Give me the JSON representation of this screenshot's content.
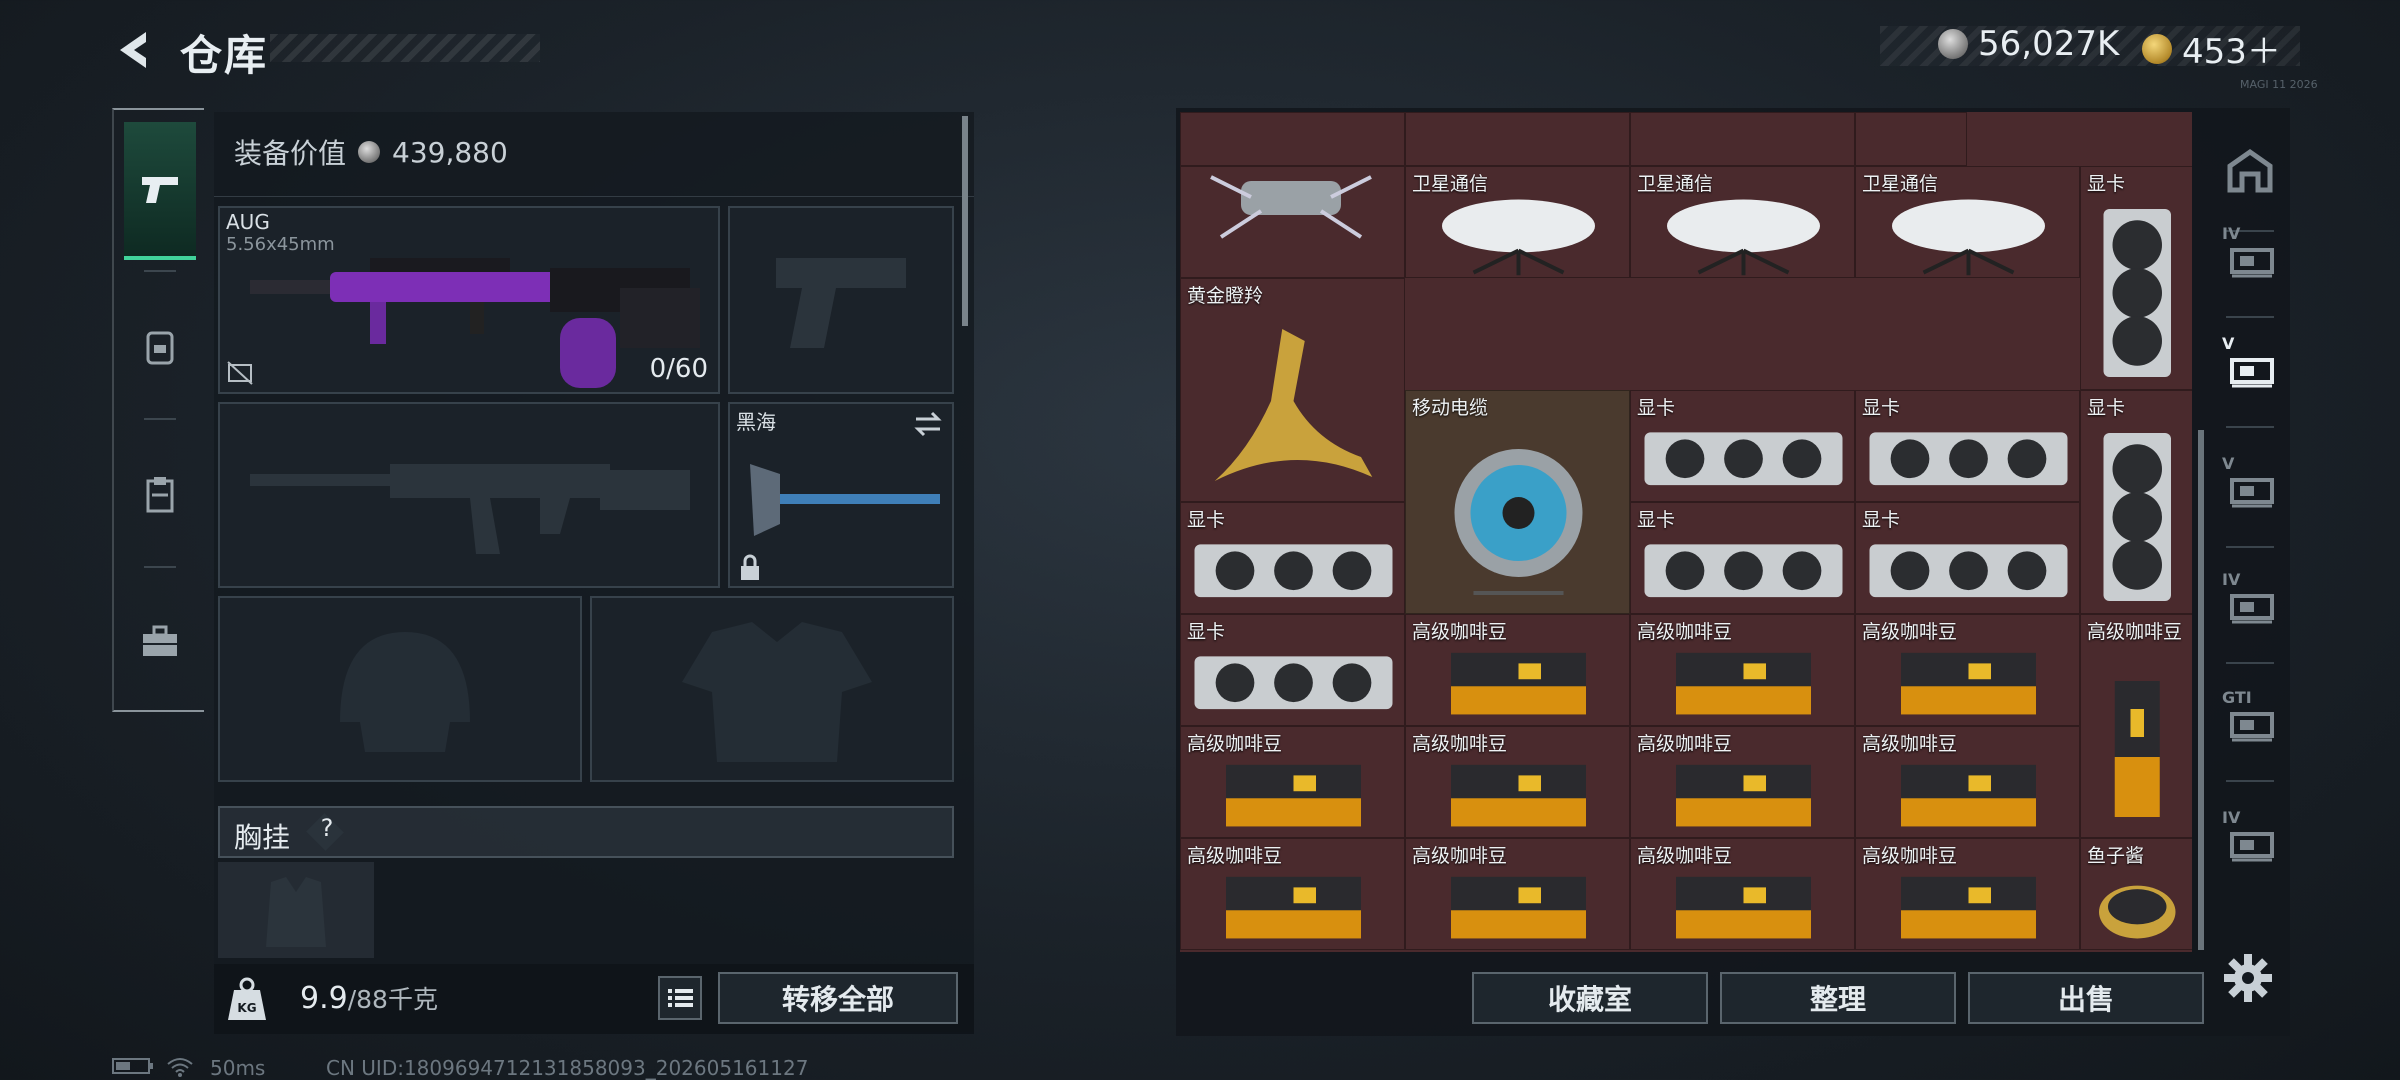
{
  "header": {
    "title": "仓库",
    "currency_silver": "56,027K",
    "currency_gold": "453＋",
    "tiny_label": "MAGI 11 2026"
  },
  "categories": [
    {
      "name": "weapons",
      "icon": "pistol-icon",
      "active": true
    },
    {
      "name": "gear",
      "icon": "backpack-icon",
      "active": false
    },
    {
      "name": "clipboard",
      "icon": "clipboard-icon",
      "active": false
    },
    {
      "name": "toolbox",
      "icon": "toolbox-icon",
      "active": false
    }
  ],
  "loadout": {
    "equipment_value_label": "装备价值",
    "equipment_value": "439,880",
    "primary": {
      "name": "AUG",
      "caliber": "5.56x45mm",
      "ammo": "0/60"
    },
    "melee": {
      "name": "黑海"
    },
    "chest_rig_label": "胸挂",
    "help": "?"
  },
  "bottom": {
    "weight_current": "9.9",
    "weight_max": "/88千克",
    "transfer_all": "转移全部"
  },
  "status": {
    "ping": "50ms",
    "uid": "CN UID:1809694712131858093_202605161127"
  },
  "inventory": {
    "items": [
      {
        "name": "卫星通信",
        "kind": "dish"
      },
      {
        "name": "卫星通信",
        "kind": "dish"
      },
      {
        "name": "卫星通信",
        "kind": "dish"
      },
      {
        "name": "显卡",
        "kind": "gpu-v"
      },
      {
        "name": "黄金瞪羚",
        "kind": "gazelle"
      },
      {
        "name": "移动电缆",
        "kind": "reel"
      },
      {
        "name": "显卡",
        "kind": "gpu"
      },
      {
        "name": "显卡",
        "kind": "gpu"
      },
      {
        "name": "显卡",
        "kind": "gpu-v"
      },
      {
        "name": "显卡",
        "kind": "gpu"
      },
      {
        "name": "显卡",
        "kind": "gpu"
      },
      {
        "name": "显卡",
        "kind": "gpu"
      },
      {
        "name": "显卡",
        "kind": "gpu"
      },
      {
        "name": "高级咖啡豆",
        "kind": "coffee"
      },
      {
        "name": "高级咖啡豆",
        "kind": "coffee"
      },
      {
        "name": "高级咖啡豆",
        "kind": "coffee"
      },
      {
        "name": "高级咖啡豆",
        "kind": "coffee-v"
      },
      {
        "name": "高级咖啡豆",
        "kind": "coffee"
      },
      {
        "name": "高级咖啡豆",
        "kind": "coffee"
      },
      {
        "name": "高级咖啡豆",
        "kind": "coffee"
      },
      {
        "name": "高级咖啡豆",
        "kind": "coffee"
      },
      {
        "name": "高级咖啡豆",
        "kind": "coffee"
      },
      {
        "name": "高级咖啡豆",
        "kind": "coffee"
      },
      {
        "name": "高级咖啡豆",
        "kind": "coffee"
      },
      {
        "name": "高级咖啡豆",
        "kind": "coffee"
      },
      {
        "name": "鱼子酱",
        "kind": "caviar"
      }
    ],
    "actions": {
      "collection": "收藏室",
      "sort": "整理",
      "sell": "出售"
    }
  },
  "right_nav": [
    {
      "icon": "home-icon",
      "label": ""
    },
    {
      "icon": "warehouse-1-icon",
      "label": "IV"
    },
    {
      "icon": "warehouse-2-icon",
      "label": "V"
    },
    {
      "icon": "warehouse-3-icon",
      "label": "V"
    },
    {
      "icon": "warehouse-4-icon",
      "label": "IV"
    },
    {
      "icon": "warehouse-5-icon",
      "label": "GTI"
    },
    {
      "icon": "warehouse-6-icon",
      "label": "IV"
    }
  ],
  "colors": {
    "accent": "#41d39b",
    "grid_bg": "#4a2a2d",
    "panel": "#141a20"
  }
}
